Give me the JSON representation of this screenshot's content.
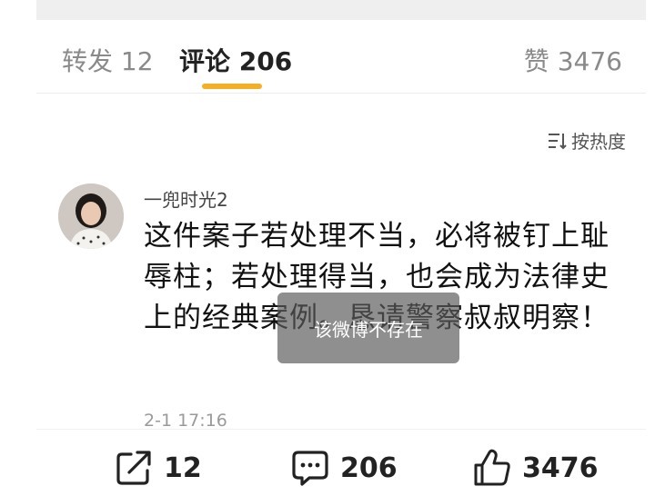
{
  "tabs": {
    "forward_label": "转发 12",
    "comment_label": "评论 206",
    "like_label": "赞 3476"
  },
  "sort": {
    "label": "按热度",
    "icon": "sort-icon"
  },
  "comment": {
    "username": "一兜时光2",
    "text": "这件案子若处理不当，必将被钉上耻辱柱；若处理得当，也会成为法律史上的经典案例。恳请警察叔叔明察！",
    "timestamp": "2-1 17:16"
  },
  "toast": {
    "text": "该微博不存在"
  },
  "actions": {
    "share_count": "12",
    "comment_count": "206",
    "like_count": "3476"
  },
  "colors": {
    "accent": "#f3b027",
    "text": "#111111",
    "muted": "#9a9a9a"
  }
}
